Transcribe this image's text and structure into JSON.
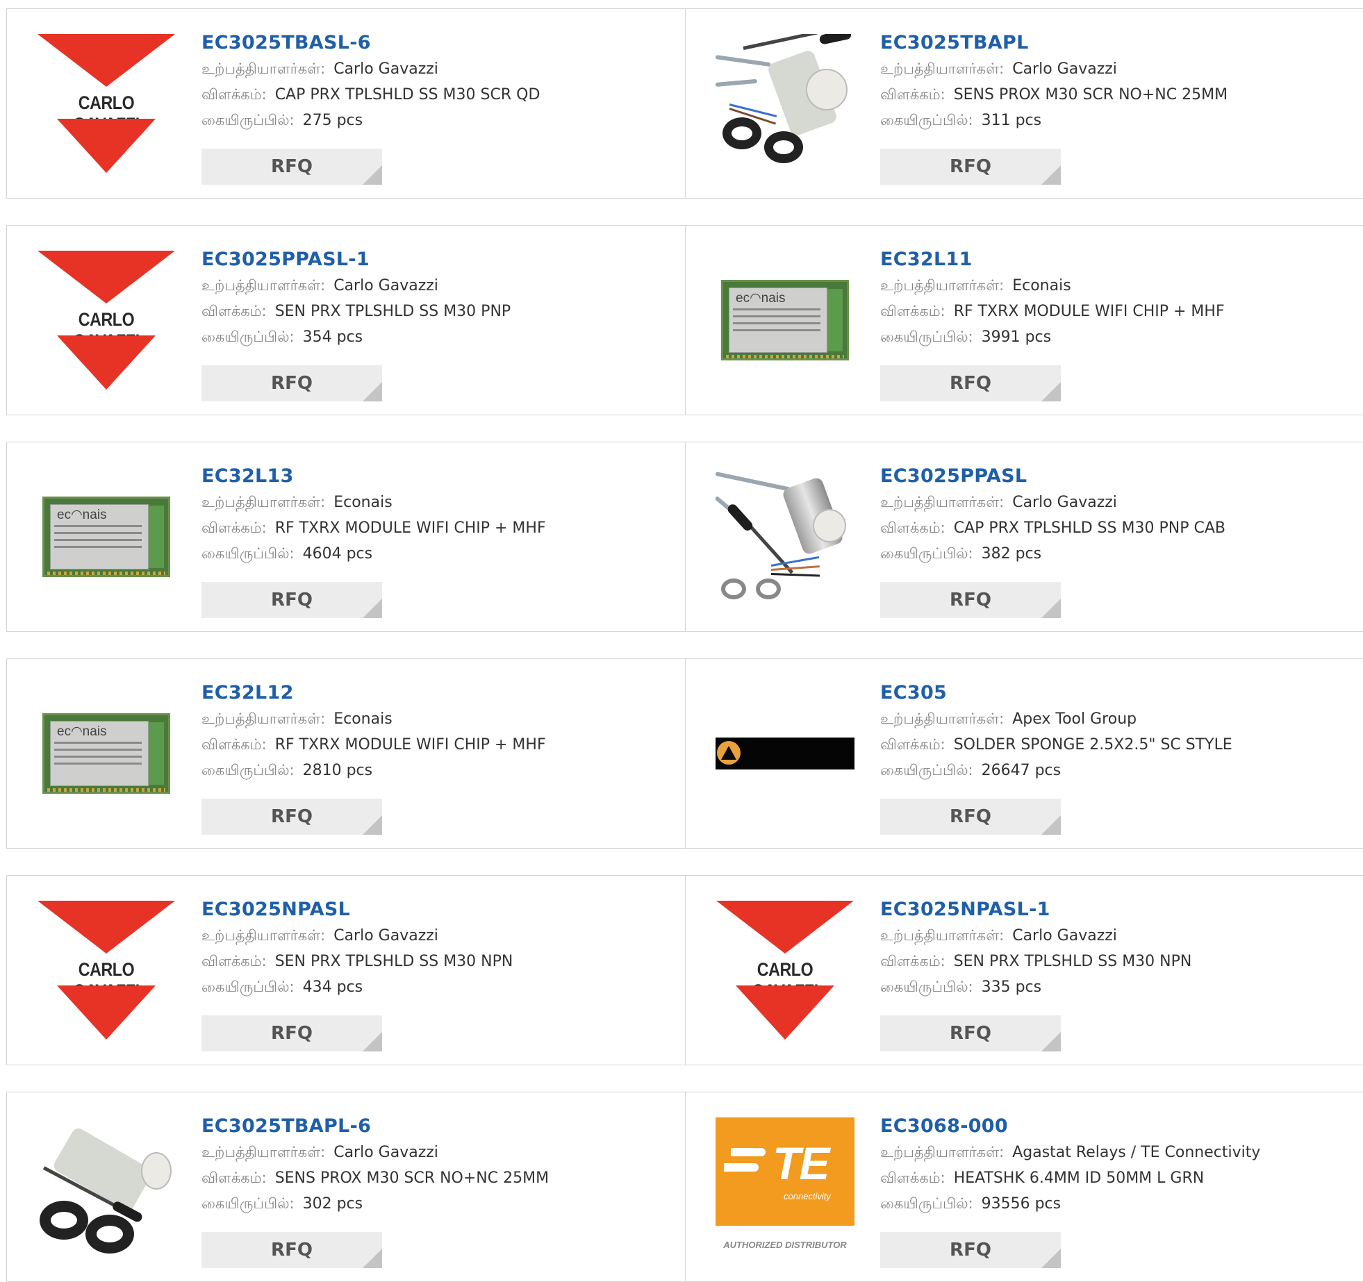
{
  "labels": {
    "manufacturer": "உற்பத்தியாளர்கள்:",
    "description": "விளக்கம்:",
    "stock": "கையிருப்பில்:",
    "rfq": "RFQ"
  },
  "products": [
    {
      "part": "EC3025TBASL-6",
      "manufacturer": "Carlo Gavazzi",
      "description": "CAP PRX TPLSHLD SS M30 SCR QD",
      "stock": "275 pcs",
      "image": "carlo-gavazzi-logo"
    },
    {
      "part": "EC3025TBAPL",
      "manufacturer": "Carlo Gavazzi",
      "description": "SENS PROX M30 SCR NO+NC 25MM",
      "stock": "311 pcs",
      "image": "proximity-sensor-photo"
    },
    {
      "part": "EC3025PPASL-1",
      "manufacturer": "Carlo Gavazzi",
      "description": "SEN PRX TPLSHLD SS M30 PNP",
      "stock": "354 pcs",
      "image": "carlo-gavazzi-logo"
    },
    {
      "part": "EC32L11",
      "manufacturer": "Econais",
      "description": "RF TXRX MODULE WIFI CHIP + MHF",
      "stock": "3991 pcs",
      "image": "wifi-module-photo",
      "brand": "ec◠nais"
    },
    {
      "part": "EC32L13",
      "manufacturer": "Econais",
      "description": "RF TXRX MODULE WIFI CHIP + MHF",
      "stock": "4604 pcs",
      "image": "wifi-module-photo",
      "brand": "ec◠nais"
    },
    {
      "part": "EC3025PPASL",
      "manufacturer": "Carlo Gavazzi",
      "description": "CAP PRX TPLSHLD SS M30 PNP CAB",
      "stock": "382 pcs",
      "image": "steel-sensor-photo"
    },
    {
      "part": "EC32L12",
      "manufacturer": "Econais",
      "description": "RF TXRX MODULE WIFI CHIP + MHF",
      "stock": "2810 pcs",
      "image": "wifi-module-photo",
      "brand": "ec◠nais"
    },
    {
      "part": "EC305",
      "manufacturer": "Apex Tool Group",
      "description": "SOLDER SPONGE 2.5X2.5\" SC STYLE",
      "stock": "26647 pcs",
      "image": "apex-logo"
    },
    {
      "part": "EC3025NPASL",
      "manufacturer": "Carlo Gavazzi",
      "description": "SEN PRX TPLSHLD SS M30 NPN",
      "stock": "434 pcs",
      "image": "carlo-gavazzi-logo"
    },
    {
      "part": "EC3025NPASL-1",
      "manufacturer": "Carlo Gavazzi",
      "description": "SEN PRX TPLSHLD SS M30 NPN",
      "stock": "335 pcs",
      "image": "carlo-gavazzi-logo"
    },
    {
      "part": "EC3025TBAPL-6",
      "manufacturer": "Carlo Gavazzi",
      "description": "SENS PROX M30 SCR NO+NC 25MM",
      "stock": "302 pcs",
      "image": "proximity-sensor-photo-alt"
    },
    {
      "part": "EC3068-000",
      "manufacturer": "Agastat Relays / TE Connectivity",
      "description": "HEATSHK 6.4MM ID 50MM L GRN",
      "stock": "93556 pcs",
      "image": "te-connectivity-logo"
    }
  ],
  "logos": {
    "carlo_gavazzi": "CARLO GAVAZZI",
    "te": "TE",
    "te_sub": "connectivity",
    "te_auth": "AUTHORIZED DISTRIBUTOR"
  },
  "colors": {
    "part_link": "#1f5fa8",
    "label": "#888888",
    "rfq_bg": "#ececec",
    "carlo_red": "#e63325",
    "te_orange": "#f39b1e"
  }
}
